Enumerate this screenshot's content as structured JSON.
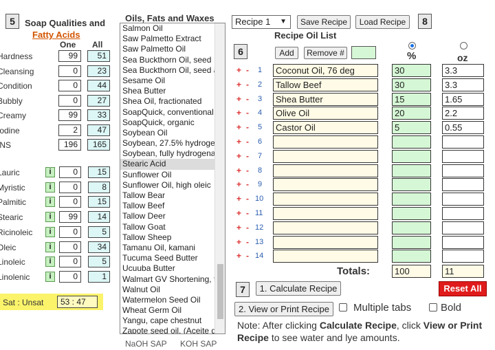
{
  "section5": {
    "number": "5",
    "title": "Soap Qualities and",
    "link": "Fatty Acids",
    "col_one": "One",
    "col_all": "All",
    "qualities": [
      {
        "label": "Hardness",
        "one": "99",
        "all": "51"
      },
      {
        "label": "Cleansing",
        "one": "0",
        "all": "23"
      },
      {
        "label": "Condition",
        "one": "0",
        "all": "44"
      },
      {
        "label": "Bubbly",
        "one": "0",
        "all": "27"
      },
      {
        "label": "Creamy",
        "one": "99",
        "all": "33"
      },
      {
        "label": "Iodine",
        "one": "2",
        "all": "47"
      },
      {
        "label": "INS",
        "one": "196",
        "all": "165"
      }
    ],
    "fatty_acids": [
      {
        "label": "Lauric",
        "one": "0",
        "all": "15"
      },
      {
        "label": "Myristic",
        "one": "0",
        "all": "8"
      },
      {
        "label": "Palmitic",
        "one": "0",
        "all": "15"
      },
      {
        "label": "Stearic",
        "one": "99",
        "all": "14"
      },
      {
        "label": "Ricinoleic",
        "one": "0",
        "all": "5"
      },
      {
        "label": "Oleic",
        "one": "0",
        "all": "34"
      },
      {
        "label": "Linoleic",
        "one": "0",
        "all": "5"
      },
      {
        "label": "Linolenic",
        "one": "0",
        "all": "1"
      }
    ],
    "info_button": "i",
    "sat_label": "Sat : Unsat",
    "sat_value": "53 : 47"
  },
  "oils": {
    "header": "Oils, Fats and Waxes",
    "items": [
      "Salmon Oil",
      "Saw Palmetto Extract",
      "Saw Palmetto Oil",
      "Sea Buckthorn Oil, seed",
      "Sea Buckthorn Oil, seed a",
      "Sesame Oil",
      "Shea Butter",
      "Shea Oil, fractionated",
      "SoapQuick, conventional",
      "SoapQuick, organic",
      "Soybean Oil",
      "Soybean, 27.5% hydrogen",
      "Soybean, fully hydrogenat",
      "Stearic Acid",
      "Sunflower Oil",
      "Sunflower Oil, high oleic",
      "Tallow Bear",
      "Tallow Beef",
      "Tallow Deer",
      "Tallow Goat",
      "Tallow Sheep",
      "Tamanu Oil, kamani",
      "Tucuma Seed Butter",
      "Ucuuba Butter",
      "Walmart GV Shortening, t",
      "Walnut Oil",
      "Watermelon Seed Oil",
      "Wheat Germ Oil",
      "Yangu, cape chestnut",
      "Zapote seed oil, (Aceite d"
    ],
    "selected_index": 13,
    "naoh": "NaOH SAP",
    "koh": "KOH SAP"
  },
  "toolbar": {
    "recipe_select": "Recipe 1",
    "save": "Save Recipe",
    "load": "Load Recipe",
    "section8": "8"
  },
  "recipe": {
    "section6": "6",
    "title": "Recipe Oil List",
    "add": "Add",
    "remove": "Remove #",
    "pct_header": "%",
    "oz_header": "oz",
    "rows": [
      {
        "n": "1",
        "oil": "Coconut Oil, 76 deg",
        "pct": "30",
        "oz": "3.3"
      },
      {
        "n": "2",
        "oil": "Tallow Beef",
        "pct": "30",
        "oz": "3.3"
      },
      {
        "n": "3",
        "oil": "Shea Butter",
        "pct": "15",
        "oz": "1.65"
      },
      {
        "n": "4",
        "oil": "Olive Oil",
        "pct": "20",
        "oz": "2.2"
      },
      {
        "n": "5",
        "oil": "Castor Oil",
        "pct": "5",
        "oz": "0.55"
      },
      {
        "n": "6",
        "oil": "",
        "pct": "",
        "oz": ""
      },
      {
        "n": "7",
        "oil": "",
        "pct": "",
        "oz": ""
      },
      {
        "n": "8",
        "oil": "",
        "pct": "",
        "oz": ""
      },
      {
        "n": "9",
        "oil": "",
        "pct": "",
        "oz": ""
      },
      {
        "n": "10",
        "oil": "",
        "pct": "",
        "oz": ""
      },
      {
        "n": "11",
        "oil": "",
        "pct": "",
        "oz": ""
      },
      {
        "n": "12",
        "oil": "",
        "pct": "",
        "oz": ""
      },
      {
        "n": "13",
        "oil": "",
        "pct": "",
        "oz": ""
      },
      {
        "n": "14",
        "oil": "",
        "pct": "",
        "oz": ""
      }
    ],
    "totals_label": "Totals:",
    "total_pct": "100",
    "total_oz": "11",
    "reset": "Reset All",
    "plus": "+",
    "minus": "-"
  },
  "actions": {
    "section7": "7",
    "calculate": "1. Calculate Recipe",
    "view_print": "2. View or Print Recipe",
    "multiple_tabs": "Multiple tabs",
    "bold": "Bold",
    "note_prefix": "Note: After clicking",
    "note_calc": "Calculate Recipe",
    "note_mid": ", click",
    "note_view": "View or Print Recipe",
    "note_suffix": "to see water and lye amounts."
  },
  "colors": {
    "accent_orange": "#d35400",
    "highlight_yellow": "#fbf36a",
    "reset_red": "#e01b1b",
    "pct_green": "#d5f7d5",
    "oil_cream": "#fffbe6"
  }
}
